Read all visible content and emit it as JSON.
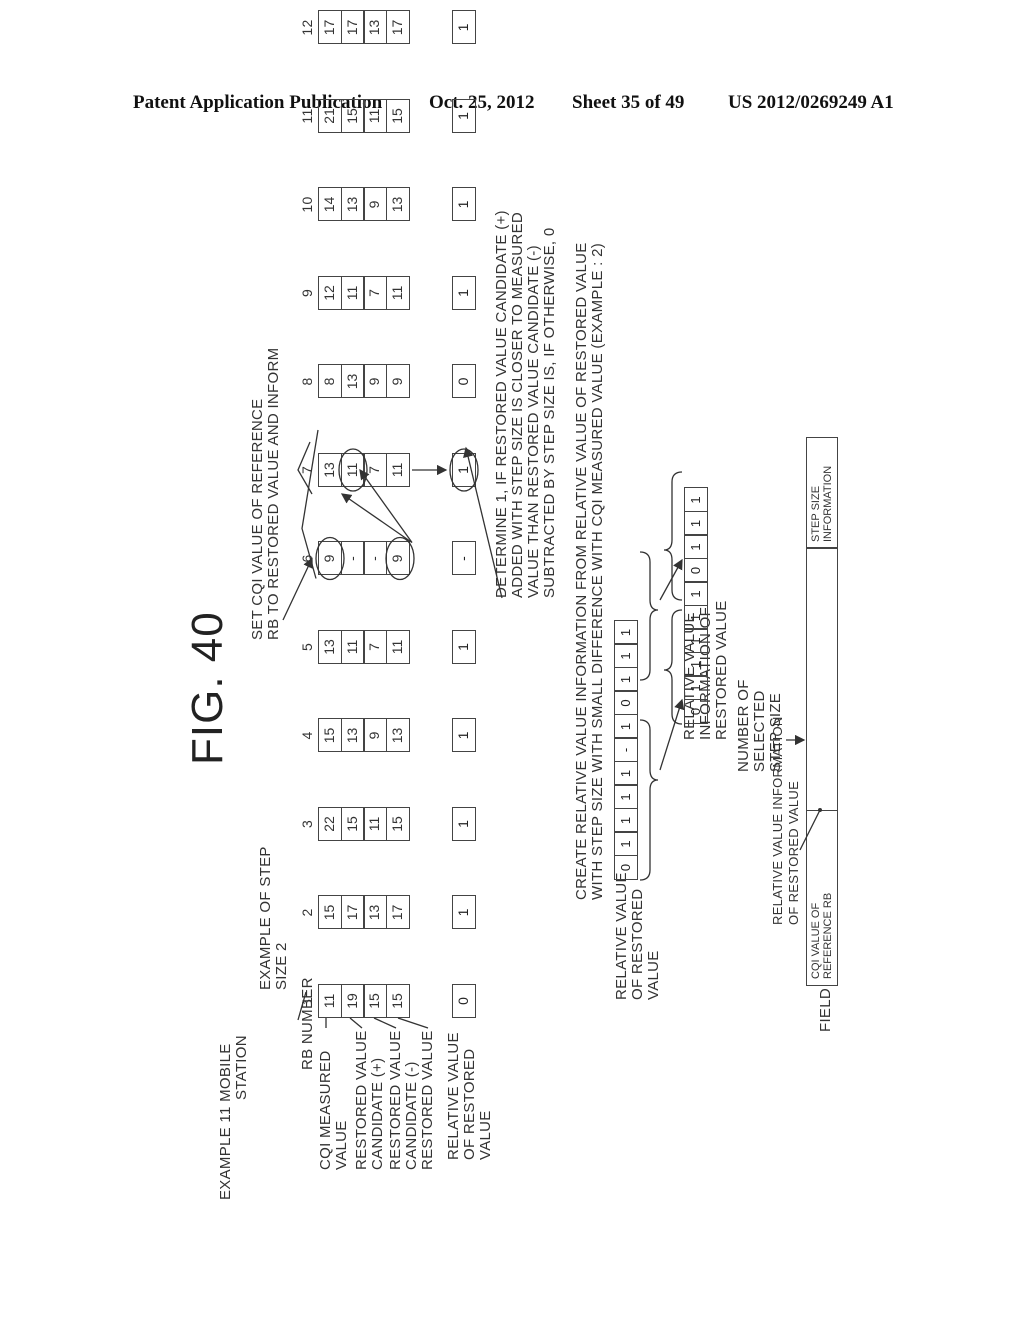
{
  "header": {
    "publication": "Patent Application Publication",
    "date": "Oct. 25, 2012",
    "sheet": "Sheet 35 of 49",
    "number": "US 2012/0269249 A1"
  },
  "figure": {
    "title": "FIG. 40",
    "example_label": "EXAMPLE 11  MOBILE",
    "example_label_2": "STATION",
    "step_example_1": "EXAMPLE OF STEP",
    "step_example_2": "SIZE 2",
    "set_note_1": "SET CQI VALUE OF REFERENCE",
    "set_note_2": "RB TO RESTORED VALUE AND INFORM",
    "determine_note": [
      "DETERMINE 1, IF RESTORED VALUE CANDIDATE (+)",
      "ADDED WITH STEP SIZE IS CLOSER TO MEASURED",
      "VALUE THAN RESTORED VALUE CANDIDATE (-)",
      "SUBTRACTED BY STEP SIZE IS, IF OTHERWISE, 0"
    ],
    "row_labels": {
      "rb_number": "RB NUMBER",
      "cqi_1": "CQI MEASURED",
      "cqi_2": "VALUE",
      "cand_plus_1": "RESTORED VALUE",
      "cand_plus_2": "CANDIDATE (+)",
      "cand_minus_1": "RESTORED VALUE",
      "cand_minus_2": "CANDIDATE (-)",
      "restored": "RESTORED VALUE",
      "relative_1": "RELATIVE VALUE",
      "relative_2": "OF RESTORED",
      "relative_3": "VALUE"
    },
    "table": {
      "rb_numbers": [
        "1",
        "2",
        "3",
        "4",
        "5",
        "6",
        "7",
        "8",
        "9",
        "10",
        "11",
        "12"
      ],
      "cqi_measured": [
        "11",
        "15",
        "22",
        "15",
        "13",
        "9",
        "13",
        "8",
        "12",
        "14",
        "21",
        "17"
      ],
      "candidate_plus": [
        "19",
        "17",
        "15",
        "13",
        "11",
        "-",
        "11",
        "13",
        "11",
        "13",
        "15",
        "17"
      ],
      "candidate_minus": [
        "15",
        "13",
        "11",
        "9",
        "7",
        "-",
        "7",
        "9",
        "7",
        "9",
        "11",
        "13"
      ],
      "restored": [
        "15",
        "17",
        "15",
        "13",
        "11",
        "9",
        "11",
        "9",
        "11",
        "13",
        "15",
        "17"
      ],
      "relative": [
        "0",
        "1",
        "1",
        "1",
        "1",
        "-",
        "1",
        "0",
        "1",
        "1",
        "1",
        "1"
      ]
    },
    "create_note_1": "CREATE RELATIVE VALUE INFORMATION FROM RELATIVE VALUE OF RESTORED VALUE",
    "create_note_2": "WITH STEP SIZE WITH SMALL DIFFERENCE WITH CQI MEASURED VALUE (EXAMPLE : 2)",
    "relative_label_1": "RELATIVE VALUE",
    "relative_label_2": "OF RESTORED",
    "relative_label_3": "VALUE",
    "relative_bits": [
      "0",
      "1",
      "1",
      "1",
      "1",
      "-",
      "1",
      "0",
      "1",
      "1",
      "1"
    ],
    "info_label_1": "RELATIVE VALUE",
    "info_label_2": "INFORMATION OF",
    "info_label_3": "RESTORED VALUE",
    "info_bits": [
      "0",
      "1",
      "1",
      "1",
      "1",
      "1",
      "0",
      "1",
      "1",
      "1"
    ],
    "number_selected_1": "NUMBER OF",
    "number_selected_2": "SELECTED",
    "number_selected_3": "STEP SIZE",
    "rel_info_note_1": "RELATIVE VALUE INFORMATION",
    "rel_info_note_2": "OF RESTORED VALUE",
    "field_label": "FIELD",
    "field_cells": {
      "cqi_1": "CQI VALUE OF",
      "cqi_2": "REFERENCE RB",
      "step_1": "STEP SIZE",
      "step_2": "INFORMATION"
    }
  }
}
